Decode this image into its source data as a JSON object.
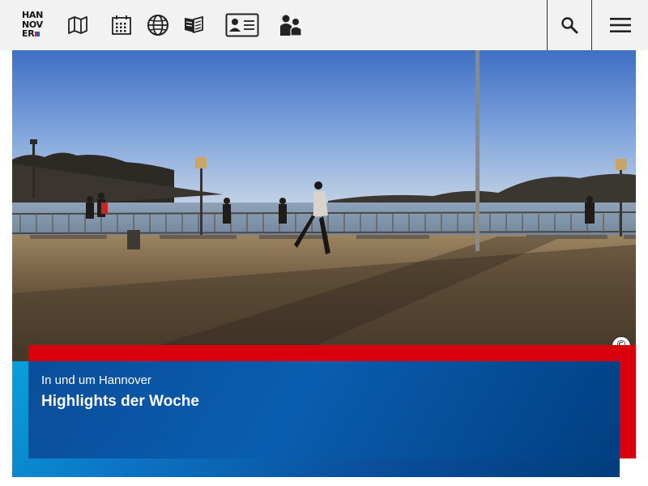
{
  "header": {
    "logo_lines": [
      "HAN",
      "NOV",
      "ER"
    ],
    "icons": [
      "map-icon",
      "calendar-icon",
      "globe-icon",
      "book-icon",
      "id-card-icon",
      "people-icon"
    ],
    "search_icon": "search-icon",
    "menu_icon": "hamburger-menu-icon"
  },
  "hero": {
    "copyright_symbol": "©",
    "kicker": "In und um Hannover",
    "headline": "Highlights der Woche"
  },
  "colors": {
    "header_bg": "#f2f2f2",
    "accent_red": "#d9000d",
    "accent_blue": "#0a4e9a",
    "light_blue": "#0aa0dc"
  }
}
